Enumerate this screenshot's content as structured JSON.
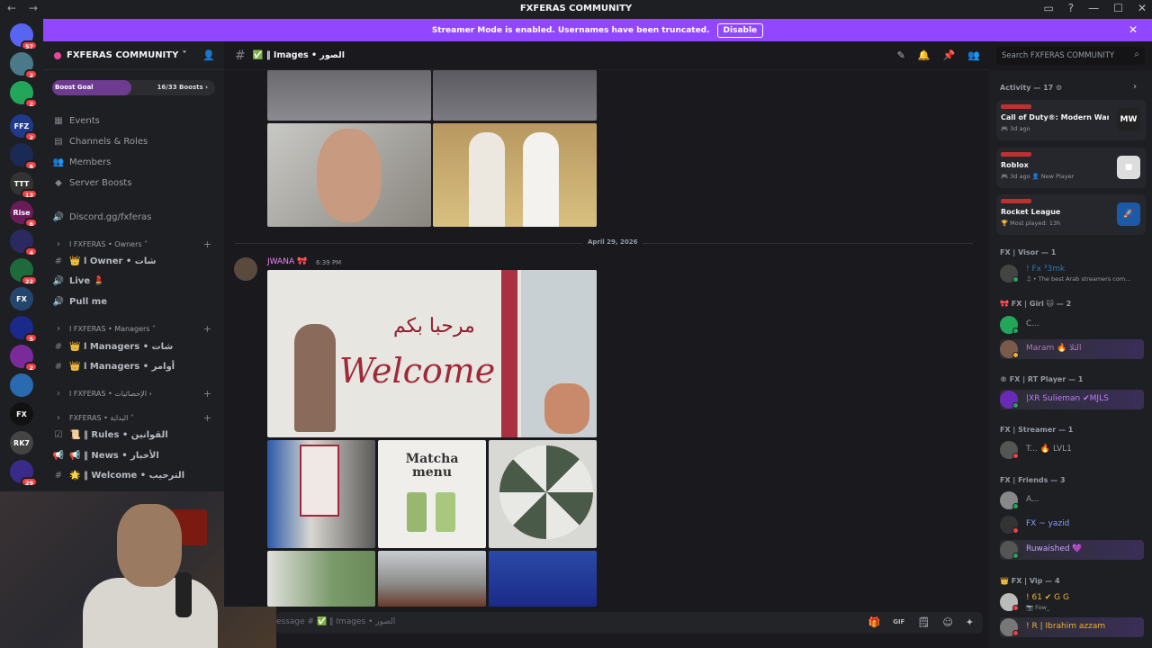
{
  "window": {
    "title": "FXFERAS COMMUNITY",
    "back": "←",
    "forward": "→",
    "controls": [
      "▭",
      "?",
      "—",
      "☐",
      "✕"
    ]
  },
  "servers": [
    {
      "label": "",
      "badge": "57",
      "color": "#5865f2"
    },
    {
      "label": "",
      "badge": "2",
      "color": "#4a7a8a"
    },
    {
      "label": "",
      "badge": "2",
      "color": "#23a55a"
    },
    {
      "label": "FFZ",
      "badge": "2",
      "color": "#1f3a8a"
    },
    {
      "label": "",
      "badge": "6",
      "color": "#1b2a55"
    },
    {
      "label": "TTT",
      "badge": "13",
      "color": "#333"
    },
    {
      "label": "Rise",
      "badge": "6",
      "color": "#6a1b5a"
    },
    {
      "label": "",
      "badge": "4",
      "color": "#2a2a60"
    },
    {
      "label": "",
      "badge": "22",
      "color": "#1e6a3a"
    },
    {
      "label": "FX",
      "badge": "",
      "color": "#24466e"
    },
    {
      "label": "",
      "badge": "5",
      "color": "#1a2a8a"
    },
    {
      "label": "",
      "badge": "2",
      "color": "#7a2a9a"
    },
    {
      "label": "",
      "badge": "",
      "color": "#2a6ab0"
    },
    {
      "label": "FX",
      "badge": "",
      "color": "#111"
    },
    {
      "label": "RK7",
      "badge": "",
      "color": "#444"
    },
    {
      "label": "",
      "badge": "29",
      "color": "#3a2a8a"
    }
  ],
  "banner": {
    "text": "Streamer Mode is enabled. Usernames have been truncated.",
    "button": "Disable",
    "close": "✕"
  },
  "server": {
    "name": "FXFERAS COMMUNITY",
    "chevron": "˅",
    "invite_icon": "👤"
  },
  "boost": {
    "label": "Boost Goal",
    "progress": "16/33 Boosts",
    "chevron": "›",
    "fraction": 0.485
  },
  "sidebar": {
    "items": [
      {
        "icon": "▦",
        "label": "Events",
        "kind": "item"
      },
      {
        "icon": "▤",
        "label": "Channels & Roles",
        "kind": "item"
      },
      {
        "icon": "👥",
        "label": "Members",
        "kind": "item"
      },
      {
        "icon": "◆",
        "label": "Server Boosts",
        "kind": "item"
      },
      {
        "icon": "🔊",
        "label": "Discord.gg/fxferas",
        "kind": "item"
      },
      {
        "icon": "›",
        "label": "I FXFERAS • Owners ˅",
        "kind": "cat"
      },
      {
        "icon": "#",
        "label": "👑 ا Owner • شات",
        "kind": "ch"
      },
      {
        "icon": "🔊",
        "label": "Live 💄",
        "kind": "ch"
      },
      {
        "icon": "🔊",
        "label": "Pull me",
        "kind": "ch"
      },
      {
        "icon": "›",
        "label": "I FXFERAS • Managers ˅",
        "kind": "cat"
      },
      {
        "icon": "#",
        "label": "👑 ا Managers • شات",
        "kind": "ch"
      },
      {
        "icon": "#",
        "label": "👑 ا Managers • أوامر",
        "kind": "ch"
      },
      {
        "icon": "›",
        "label": "I FXFERAS • الإحصائيات ›",
        "kind": "cat"
      },
      {
        "icon": "›",
        "label": "FXFERAS • البداية ˅",
        "kind": "cat"
      },
      {
        "icon": "☑",
        "label": "📜 ‖ Rules • القوانين",
        "kind": "ch"
      },
      {
        "icon": "📢",
        "label": "📢 ‖ News • الأخبار",
        "kind": "ch"
      },
      {
        "icon": "#",
        "label": "🌟 ‖ Welcome • الترحيب",
        "kind": "ch"
      }
    ],
    "plus": "+"
  },
  "channel": {
    "hash": "#",
    "name": "✅ ‖ Images • الصور",
    "tools": [
      "✎",
      "🔔",
      "📌",
      "👥"
    ]
  },
  "search": {
    "placeholder": "Search FXFERAS COMMUNITY",
    "icon": "⌕"
  },
  "messages": {
    "date": "April 29, 2026",
    "author": "JWANA 🎀",
    "time": "6:39 PM",
    "welcome_sign": "Welcome",
    "arabic_sign": "مرحبا بكم",
    "matcha": "Matcha menu"
  },
  "composer": {
    "placeholder": "essage # ✅ ‖ Images • الصور",
    "tools": [
      "🎁",
      "GIF",
      "🗒",
      "☺",
      "✦"
    ]
  },
  "members": {
    "activity_header": "Activity — 17 ⚙",
    "activity_chevron": "›",
    "activities": [
      {
        "game": "Call of Duty®: Modern Warf...",
        "sub": "🎮 3d ago",
        "icon_text": "MW",
        "icon_color": "#222"
      },
      {
        "game": "Roblox",
        "sub": "🎮 3d ago  👤 New Player",
        "icon_text": "■",
        "icon_color": "#ddd"
      },
      {
        "game": "Rocket League",
        "sub": "🏆 Most played: 13h",
        "icon_text": "🚀",
        "icon_color": "#1a5aa8"
      }
    ],
    "groups": [
      {
        "title": "FX | Visor — 1",
        "members": [
          {
            "name": "! Fx ³3mk",
            "status": "♫ • The best Arab streamers com...",
            "color": "#2a7ab8",
            "dot": "#23a55a",
            "av": "#444",
            "hl": false
          }
        ]
      },
      {
        "title": "🎀 FX | Girl 🐱 — 2",
        "members": [
          {
            "name": "C...",
            "status": "",
            "color": "#949ba4",
            "dot": "#23a55a",
            "av": "#23a55a",
            "hl": false
          },
          {
            "name": "Maram 🔥 الثلا",
            "status": "",
            "color": "#b07ab8",
            "dot": "#f0b232",
            "av": "#7a5a4a",
            "hl": true
          }
        ]
      },
      {
        "title": "® FX | RT Player — 1",
        "members": [
          {
            "name": "|XR Sulieman ✔MJLS",
            "status": "",
            "color": "#c07aff",
            "dot": "#23a55a",
            "av": "#6a2ab8",
            "hl": true
          }
        ]
      },
      {
        "title": "FX | Streamer — 1",
        "members": [
          {
            "name": "T... 🔥 LVL1",
            "status": "",
            "color": "#949ba4",
            "dot": "#f23f43",
            "av": "#555",
            "hl": false
          }
        ]
      },
      {
        "title": "FX | Friends — 3",
        "members": [
          {
            "name": "A...",
            "status": "",
            "color": "#949ba4",
            "dot": "#23a55a",
            "av": "#888",
            "hl": false
          },
          {
            "name": "FX ~ yazid",
            "status": "",
            "color": "#8a9aff",
            "dot": "#f23f43",
            "av": "#333",
            "hl": false
          },
          {
            "name": "Ruwaished 💜",
            "status": "",
            "color": "#c8a0ff",
            "dot": "#23a55a",
            "av": "#555",
            "hl": true
          }
        ]
      },
      {
        "title": "👑 FX | Vip — 4",
        "members": [
          {
            "name": "! 61 ✔ G G",
            "status": "📷 Fow_",
            "color": "#f0b232",
            "dot": "#f23f43",
            "av": "#bbb",
            "hl": false
          },
          {
            "name": "! R | Ibrahim azzam",
            "status": "",
            "color": "#f0b232",
            "dot": "#f23f43",
            "av": "#777",
            "hl": true
          }
        ]
      }
    ]
  }
}
